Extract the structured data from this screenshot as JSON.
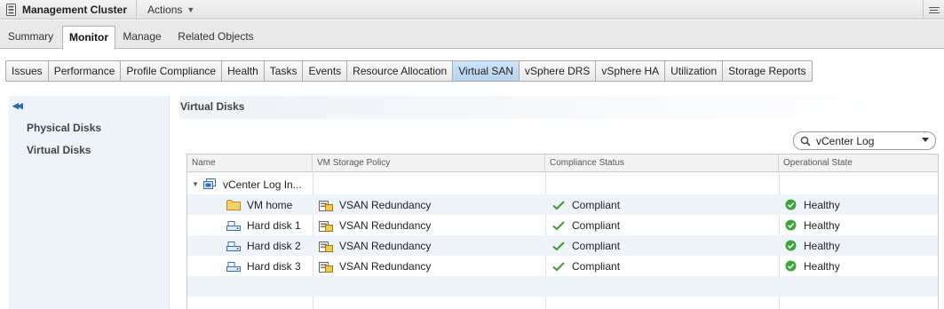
{
  "header": {
    "title": "Management Cluster",
    "actions_label": "Actions"
  },
  "main_tabs": [
    {
      "label": "Summary",
      "active": false
    },
    {
      "label": "Monitor",
      "active": true
    },
    {
      "label": "Manage",
      "active": false
    },
    {
      "label": "Related Objects",
      "active": false
    }
  ],
  "sub_tabs": [
    {
      "label": "Issues",
      "active": false
    },
    {
      "label": "Performance",
      "active": false
    },
    {
      "label": "Profile Compliance",
      "active": false
    },
    {
      "label": "Health",
      "active": false
    },
    {
      "label": "Tasks",
      "active": false
    },
    {
      "label": "Events",
      "active": false
    },
    {
      "label": "Resource Allocation",
      "active": false
    },
    {
      "label": "Virtual SAN",
      "active": true
    },
    {
      "label": "vSphere DRS",
      "active": false
    },
    {
      "label": "vSphere HA",
      "active": false
    },
    {
      "label": "Utilization",
      "active": false
    },
    {
      "label": "Storage Reports",
      "active": false
    }
  ],
  "sidebar": {
    "items": [
      {
        "label": "Physical Disks"
      },
      {
        "label": "Virtual Disks"
      }
    ]
  },
  "content": {
    "title": "Virtual Disks",
    "filter_value": "vCenter Log"
  },
  "table": {
    "columns": [
      "Name",
      "VM Storage Policy",
      "Compliance Status",
      "Operational State"
    ],
    "parent": {
      "name": "vCenter Log In...",
      "icon": "vm-icon"
    },
    "rows": [
      {
        "name": "VM home",
        "icon": "folder-icon",
        "policy": "VSAN Redundancy",
        "compliance": "Compliant",
        "state": "Healthy"
      },
      {
        "name": "Hard disk 1",
        "icon": "hard-disk-icon",
        "policy": "VSAN Redundancy",
        "compliance": "Compliant",
        "state": "Healthy"
      },
      {
        "name": "Hard disk 2",
        "icon": "hard-disk-icon",
        "policy": "VSAN Redundancy",
        "compliance": "Compliant",
        "state": "Healthy"
      },
      {
        "name": "Hard disk 3",
        "icon": "hard-disk-icon",
        "policy": "VSAN Redundancy",
        "compliance": "Compliant",
        "state": "Healthy"
      }
    ]
  },
  "colors": {
    "active_subtab": "#b6d3ef",
    "compliant_check": "#3a9a2a",
    "healthy_badge": "#3aa53a",
    "row_alt": "#eef4fa"
  }
}
